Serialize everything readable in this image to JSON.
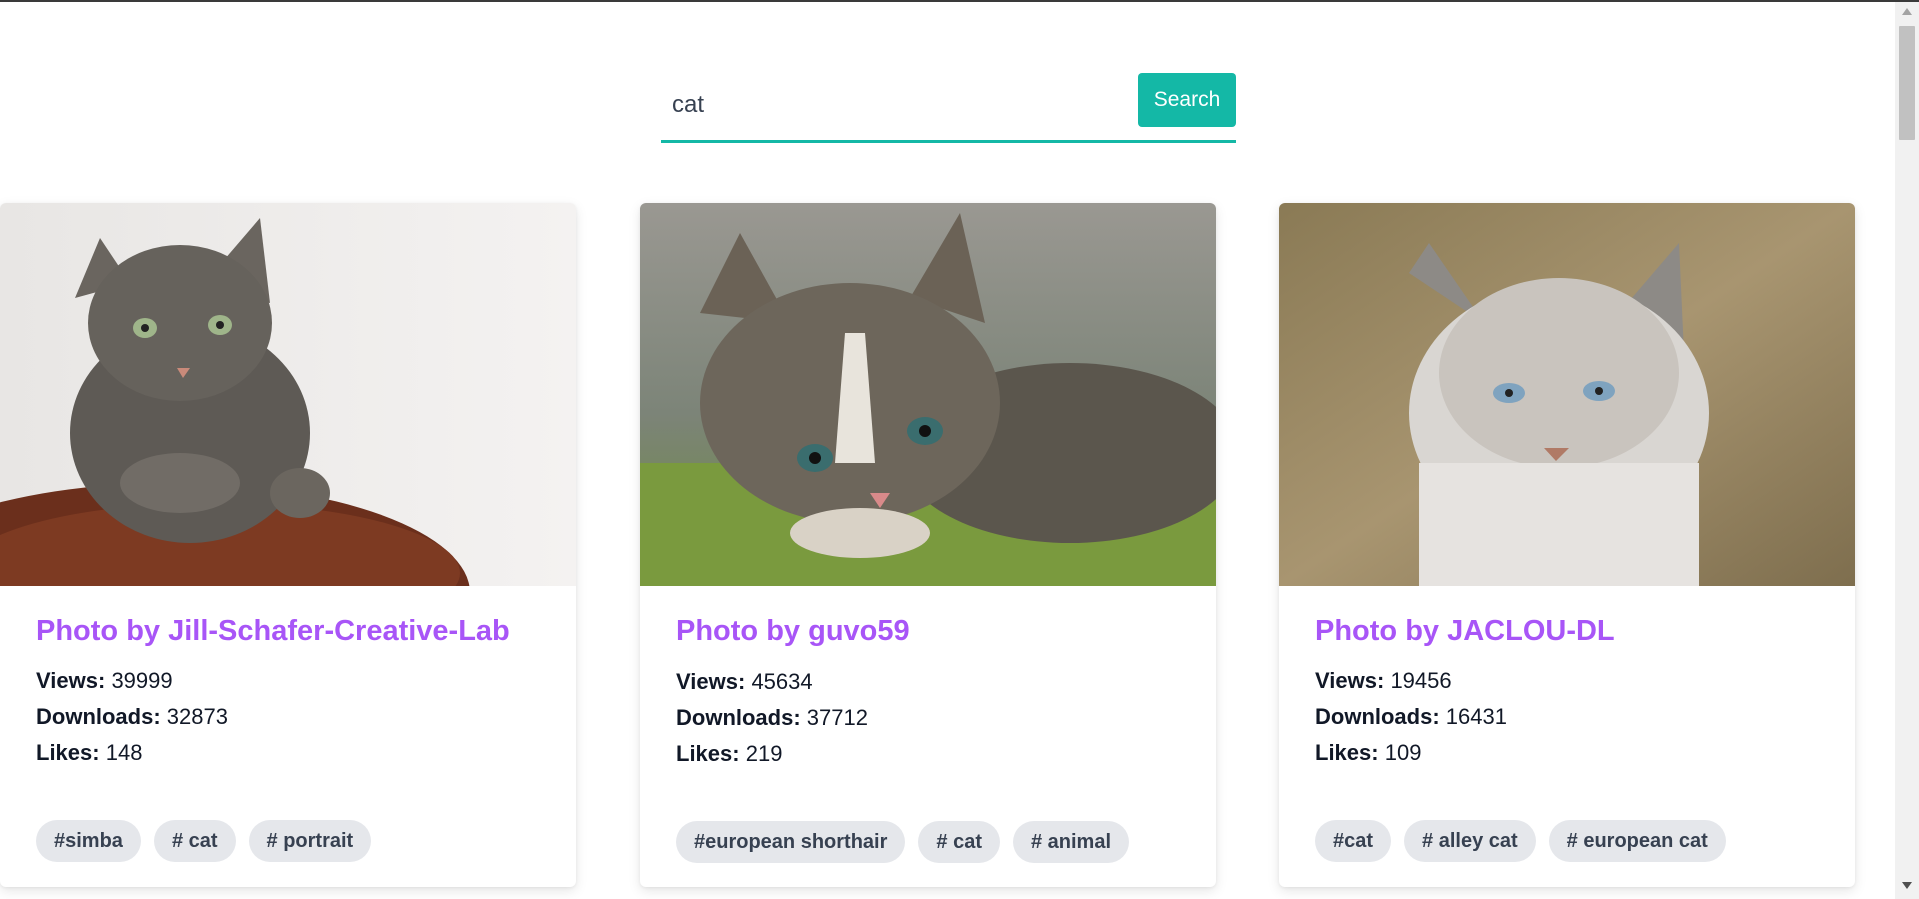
{
  "search": {
    "value": "cat",
    "button_label": "Search"
  },
  "labels": {
    "views": "Views:",
    "downloads": "Downloads:",
    "likes": "Likes:"
  },
  "cards": [
    {
      "title": "Photo by Jill-Schafer-Creative-Lab",
      "views": "39999",
      "downloads": "32873",
      "likes": "148",
      "tags": [
        "#simba",
        "# cat",
        "# portrait"
      ]
    },
    {
      "title": "Photo by guvo59",
      "views": "45634",
      "downloads": "37712",
      "likes": "219",
      "tags": [
        "#european shorthair",
        "# cat",
        "# animal"
      ]
    },
    {
      "title": "Photo by JACLOU-DL",
      "views": "19456",
      "downloads": "16431",
      "likes": "109",
      "tags": [
        "#cat",
        "# alley cat",
        "# european cat"
      ]
    }
  ],
  "colors": {
    "accent": "#14b8a6",
    "title": "#a855f7",
    "tag_bg": "#e5e7eb"
  }
}
